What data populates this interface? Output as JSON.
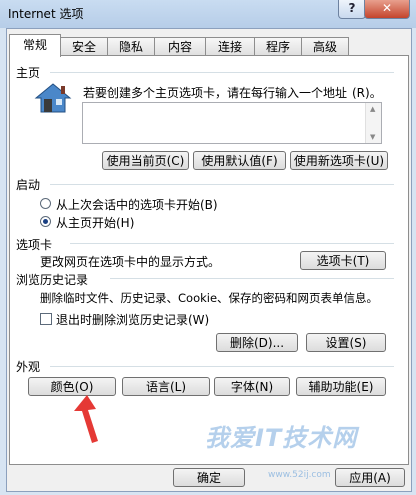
{
  "window": {
    "title": "Internet 选项",
    "help_glyph": "?",
    "close_glyph": "✕"
  },
  "tabs": [
    "常规",
    "安全",
    "隐私",
    "内容",
    "连接",
    "程序",
    "高级"
  ],
  "homepage": {
    "section_label": "主页",
    "description": "若要创建多个主页选项卡，请在每行输入一个地址",
    "description_key": "(R)。",
    "use_current": "使用当前页(C)",
    "use_default": "使用默认值(F)",
    "use_new_tab": "使用新选项卡(U)"
  },
  "startup": {
    "section_label": "启动",
    "option_last_session": "从上次会话中的选项卡开始(B)",
    "option_homepage": "从主页开始(H)"
  },
  "tab_settings": {
    "section_label": "选项卡",
    "description": "更改网页在选项卡中的显示方式。",
    "button": "选项卡(T)"
  },
  "history": {
    "section_label": "浏览历史记录",
    "description": "删除临时文件、历史记录、Cookie、保存的密码和网页表单信息。",
    "checkbox_label": "退出时删除浏览历史记录(W)",
    "delete_button": "删除(D)...",
    "settings_button": "设置(S)"
  },
  "appearance": {
    "section_label": "外观",
    "colors_button": "颜色(O)",
    "languages_button": "语言(L)",
    "fonts_button": "字体(N)",
    "accessibility_button": "辅助功能(E)"
  },
  "footer": {
    "ok_button": "确定",
    "apply_button": "应用(A)"
  },
  "watermark": {
    "text": "我爱IT技术网",
    "sub": "www.52ij.com"
  },
  "colors": {
    "arrow": "#e53935",
    "accent": "#1a3f82"
  }
}
